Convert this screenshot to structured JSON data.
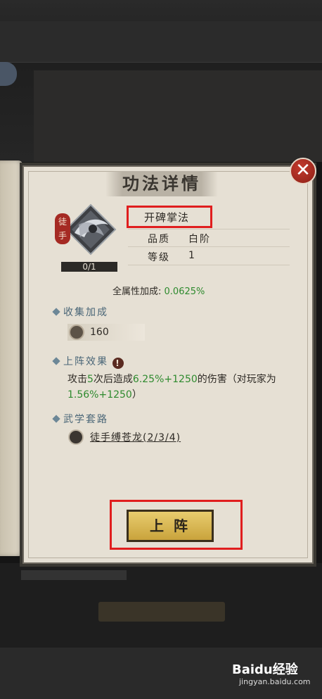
{
  "dialog": {
    "title": "功法详情",
    "close_label": "✕"
  },
  "skill": {
    "badge": "徒手",
    "progress": "0/1",
    "name": "开碑掌法",
    "quality_label": "品质",
    "quality_value": "白阶",
    "level_label": "等级",
    "level_value": "1",
    "all_attr_label": "全属性加成:",
    "all_attr_value": "0.0625%"
  },
  "collection": {
    "heading": "收集加成",
    "value": "160"
  },
  "effect": {
    "heading": "上阵效果",
    "info_icon": "!",
    "text_a": "攻击",
    "hits": "5",
    "text_b": "次后造成",
    "pct": "6.25%",
    "plus1": "+1250",
    "text_c": "的伤害（对玩家为",
    "pvp_pct": "1.56%",
    "plus2": "+1250",
    "text_d": "）"
  },
  "route": {
    "heading": "武学套路",
    "item": "徒手缚苍龙(2/3/4)"
  },
  "actions": {
    "deploy_label": "上阵"
  },
  "watermark": {
    "brand": "Baidu经验",
    "url": "jingyan.baidu.com"
  },
  "colors": {
    "accent_green": "#2e8a2e",
    "highlight_red": "#e01e1e",
    "button_gold": "#d9b750"
  }
}
